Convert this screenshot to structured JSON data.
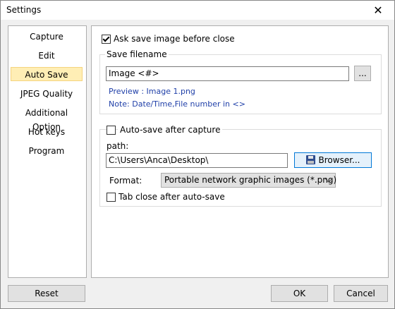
{
  "window": {
    "title": "Settings",
    "close_glyph": "✕"
  },
  "sidebar": {
    "items": [
      {
        "label": "Capture",
        "selected": false
      },
      {
        "label": "Edit",
        "selected": false
      },
      {
        "label": "Auto Save",
        "selected": true
      },
      {
        "label": "JPEG Quality",
        "selected": false
      },
      {
        "label": "Additional Option",
        "selected": false
      },
      {
        "label": "Hot keys",
        "selected": false
      },
      {
        "label": "Program",
        "selected": false
      }
    ]
  },
  "main": {
    "ask_before_close": {
      "label": "Ask save image before close",
      "checked": true
    },
    "save_filename": {
      "group_label": "Save filename",
      "value": "Image <#>",
      "browse_label": "...",
      "preview": "Preview : Image 1.png",
      "note": "Note: Date/Time,File number in <>"
    },
    "auto_save": {
      "label": "Auto-save after capture",
      "checked": false,
      "path_label": "path:",
      "path_value": "C:\\Users\\Anca\\Desktop\\",
      "browse_label": "Browser...",
      "format_label": "Format:",
      "format_value": "Portable network graphic images (*.png)",
      "tab_close_label": "Tab close after auto-save",
      "tab_close_checked": false
    }
  },
  "buttons": {
    "reset": "Reset",
    "ok": "OK",
    "cancel": "Cancel"
  },
  "icons": {
    "save_icon": "floppy-disk",
    "close_icon": "close"
  },
  "colors": {
    "selected_bg": "#ffeeb5",
    "link_text": "#1f3fa8",
    "focus_border": "#0078d7"
  }
}
